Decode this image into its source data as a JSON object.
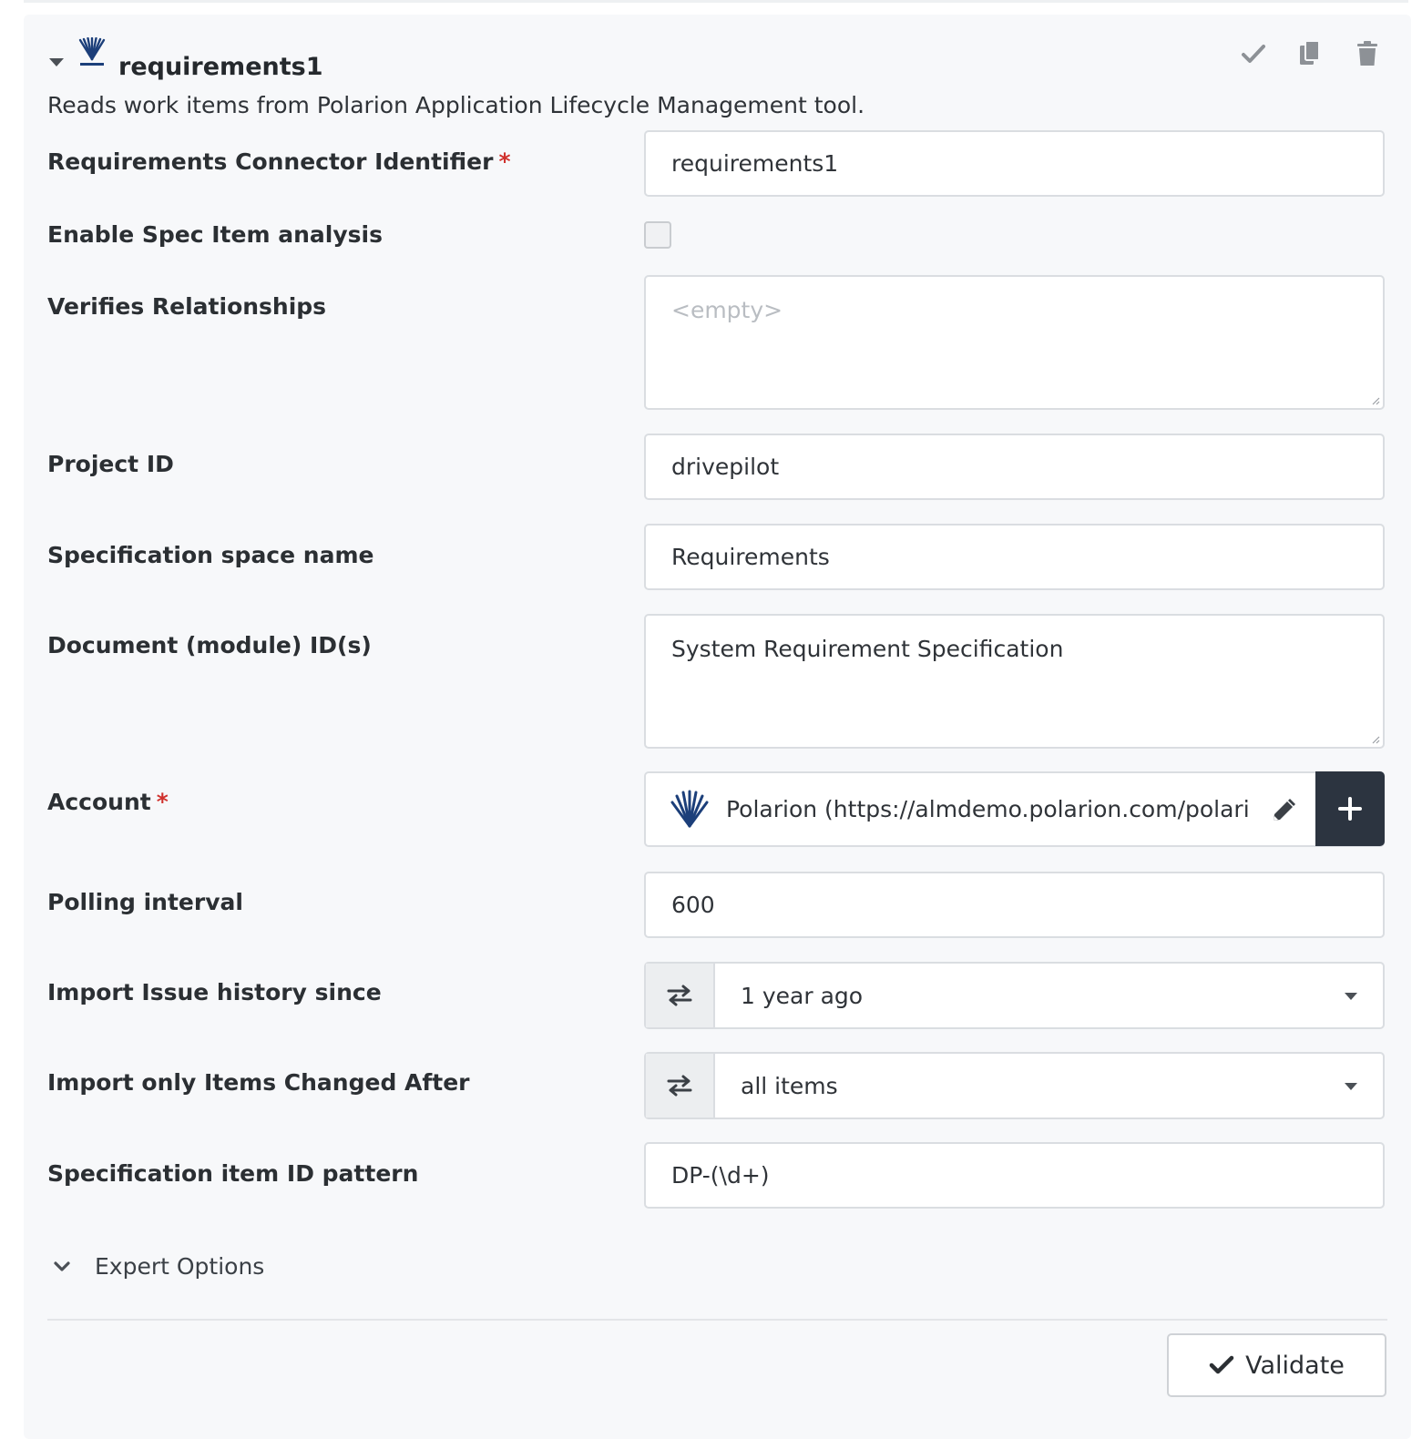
{
  "connector": {
    "title": "requirements1",
    "description": "Reads work items from Polarion Application Lifecycle Management tool.",
    "logo_icon": "polarion-logo-icon"
  },
  "header_actions": [
    {
      "name": "checkmark-icon"
    },
    {
      "name": "copy-icon"
    },
    {
      "name": "trash-icon"
    }
  ],
  "fields": {
    "identifier": {
      "label": "Requirements Connector Identifier",
      "required_mark": "*",
      "value": "requirements1"
    },
    "spec_analysis": {
      "label": "Enable Spec Item analysis",
      "checked": false
    },
    "verifies": {
      "label": "Verifies Relationships",
      "placeholder": "<empty>",
      "value": ""
    },
    "project_id": {
      "label": "Project ID",
      "value": "drivepilot"
    },
    "space_name": {
      "label": "Specification space name",
      "value": "Requirements"
    },
    "document_ids": {
      "label": "Document (module) ID(s)",
      "value": "System Requirement Specification"
    },
    "account": {
      "label": "Account",
      "required_mark": "*",
      "value": "Polarion (https://almdemo.polarion.com/polario"
    },
    "polling": {
      "label": "Polling interval",
      "value": "600"
    },
    "issue_history": {
      "label": "Import Issue history since",
      "value": "1 year ago"
    },
    "changed_after": {
      "label": "Import only Items Changed After",
      "value": "all items"
    },
    "id_pattern": {
      "label": "Specification item ID pattern",
      "value": "DP-(\\d+)"
    }
  },
  "expert_options": {
    "label": "Expert Options"
  },
  "validate": {
    "label": "Validate"
  },
  "colors": {
    "primary_dark": "#2c3440",
    "required": "#d0312d",
    "polarion_blue": "#1c3f7a"
  }
}
